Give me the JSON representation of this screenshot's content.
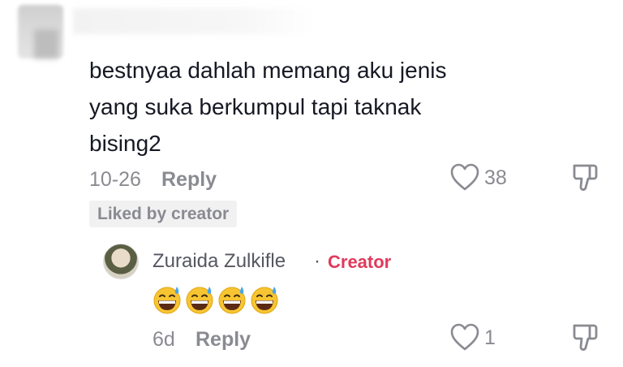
{
  "comment": {
    "lines": [
      "bestnyaa dahlah memang aku jenis",
      "yang suka berkumpul tapi taknak",
      "bising2"
    ],
    "date": "10-26",
    "reply_label": "Reply",
    "like_count": "38",
    "badge": "Liked by creator"
  },
  "reply": {
    "author": "Zuraida Zulkifle",
    "separator": "·",
    "role": "Creator",
    "emojis": [
      "grinning-sweat-emoji",
      "grinning-sweat-emoji",
      "grinning-sweat-emoji",
      "grinning-sweat-emoji"
    ],
    "date": "6d",
    "reply_label": "Reply",
    "like_count": "1"
  },
  "colors": {
    "text": "#161823",
    "muted": "#8a8b91",
    "creator": "#e03a5b",
    "badge_bg": "#f1f1f2"
  }
}
